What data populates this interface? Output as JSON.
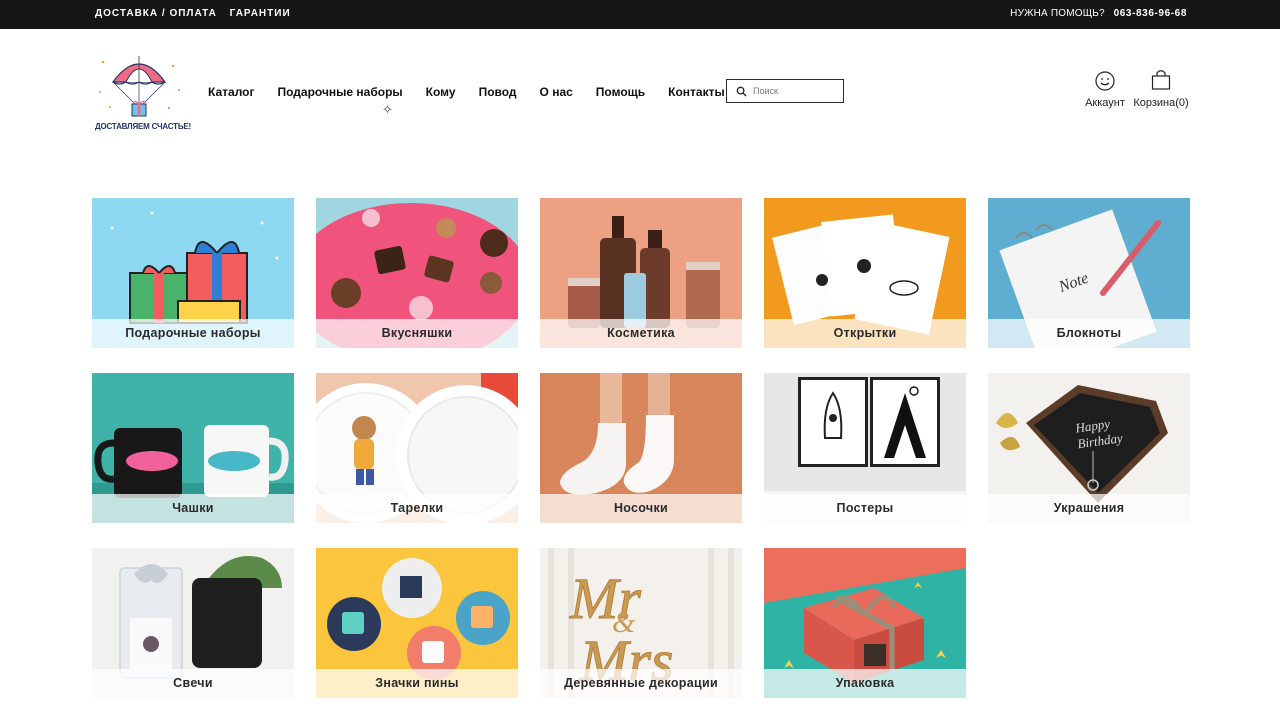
{
  "topbar": {
    "links": [
      "ДОСТАВКА / ОПЛАТА",
      "ГАРАНТИИ"
    ],
    "help_text": "НУЖНА ПОМОЩЬ?",
    "phone": "063-836-96-68"
  },
  "logo": {
    "text": "ДОСТАВЛЯЕМ СЧАСТЬЕ!"
  },
  "nav": {
    "items": [
      "Каталог",
      "Подарочные наборы",
      "Кому",
      "Повод",
      "О нас",
      "Помощь",
      "Контакты"
    ]
  },
  "search": {
    "placeholder": "Поиск"
  },
  "account": {
    "label": "Аккаунт",
    "icon": "smiley-icon"
  },
  "cart": {
    "label": "Корзина",
    "count": "(0)",
    "icon": "shopping-bag-icon"
  },
  "categories": [
    {
      "label": "Подарочные наборы",
      "icon": "gift-boxes"
    },
    {
      "label": "Вкусняшки",
      "icon": "chocolates"
    },
    {
      "label": "Косметика",
      "icon": "cosmetics-bottles"
    },
    {
      "label": "Открытки",
      "icon": "postcards"
    },
    {
      "label": "Блокноты",
      "icon": "notepad"
    },
    {
      "label": "Чашки",
      "icon": "mugs"
    },
    {
      "label": "Тарелки",
      "icon": "plates"
    },
    {
      "label": "Носочки",
      "icon": "socks"
    },
    {
      "label": "Постеры",
      "icon": "posters"
    },
    {
      "label": "Украшения",
      "icon": "necklace"
    },
    {
      "label": "Свечи",
      "icon": "candle"
    },
    {
      "label": "Значки пины",
      "icon": "pin-badges"
    },
    {
      "label": "Деревянные декорации",
      "icon": "wooden-lettering"
    },
    {
      "label": "Упаковка",
      "icon": "gift-box"
    }
  ],
  "colors": {
    "topbar_bg": "#161616",
    "caption_bg": "rgba(255,255,255,0.72)",
    "text": "#1a1a1a"
  }
}
